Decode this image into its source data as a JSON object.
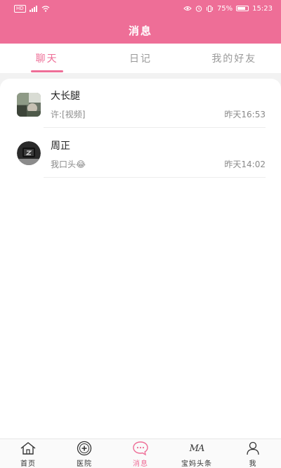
{
  "status_bar": {
    "network": "HD",
    "battery_percent": "75%",
    "battery_level": 0.75,
    "time": "15:23"
  },
  "header": {
    "title": "消息"
  },
  "tabs": [
    {
      "label": "聊天",
      "active": true
    },
    {
      "label": "日记",
      "active": false
    },
    {
      "label": "我的好友",
      "active": false
    }
  ],
  "chats": [
    {
      "name": "大长腿",
      "preview": "许:[视频]",
      "time": "昨天16:53"
    },
    {
      "name": "周正",
      "preview": "我口头",
      "emoji": "😂",
      "time": "昨天14:02"
    }
  ],
  "bottom_nav": [
    {
      "label": "首页",
      "icon": "home-icon"
    },
    {
      "label": "医院",
      "icon": "hospital-cross-icon"
    },
    {
      "label": "消息",
      "icon": "message-bubble-icon",
      "active": true
    },
    {
      "label": "宝妈头条",
      "icon": "ma-logo-icon",
      "icon_text": "MA"
    },
    {
      "label": "我",
      "icon": "person-icon"
    }
  ],
  "colors": {
    "accent": "#ee6e97",
    "text_muted": "#8a8a8a"
  }
}
